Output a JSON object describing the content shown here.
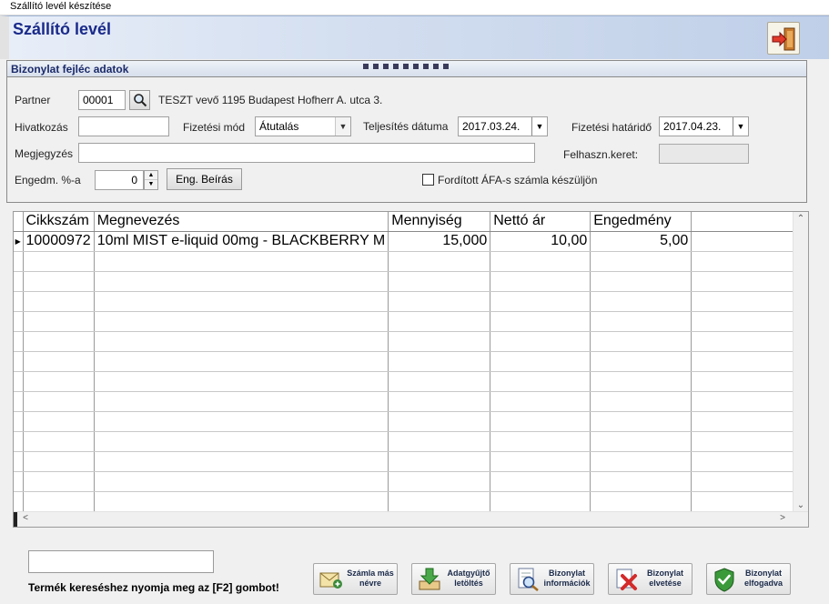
{
  "window": {
    "title": "Szállító levél készítése"
  },
  "header": {
    "title": "Szállító levél",
    "exit_icon": "exit-door-icon"
  },
  "panel": {
    "title": "Bizonylat fejléc adatok",
    "partner_label": "Partner",
    "partner_code": "00001",
    "partner_name": "TESZT vevő 1195 Budapest Hofherr A. utca 3.",
    "hivatkozas_label": "Hivatkozás",
    "hivatkozas_value": "",
    "fizetesi_mod_label": "Fizetési mód",
    "fizetesi_mod_value": "Átutalás",
    "teljesites_label": "Teljesítés dátuma",
    "teljesites_value": "2017.03.24.",
    "hatarido_label": "Fizetési határidő",
    "hatarido_value": "2017.04.23.",
    "megjegyzes_label": "Megjegyzés",
    "megjegyzes_value": "",
    "felhkeret_label": "Felhaszn.keret:",
    "felhkeret_value": "",
    "engedm_label": "Engedm. %-a",
    "engedm_value": "0",
    "eng_beiras_label": "Eng. Beírás",
    "forditott_afa_label": "Fordított ÁFA-s számla készüljön",
    "forditott_afa_checked": false
  },
  "grid": {
    "columns": [
      "Cikkszám",
      "Megnevezés",
      "Mennyiség",
      "Nettó ár",
      "Engedmény"
    ],
    "rows": [
      {
        "cikkszam": "10000972",
        "megnevezes": "10ml MIST e-liquid 00mg - BLACKBERRY M",
        "mennyiseg": "15,000",
        "netto_ar": "10,00",
        "engedmeny": "5,00"
      }
    ]
  },
  "footer": {
    "search_value": "",
    "hint": "Termék kereséshez nyomja meg az [F2] gombot!",
    "buttons": [
      {
        "line1": "Számla más",
        "line2": "névre",
        "icon": "invoice-envelope-icon"
      },
      {
        "line1": "Adatgyűjtő",
        "line2": "letöltés",
        "icon": "download-arrow-icon"
      },
      {
        "line1": "Bizonylat",
        "line2": "információk",
        "icon": "document-magnifier-icon"
      },
      {
        "line1": "Bizonylat",
        "line2": "elvetése",
        "icon": "reject-x-icon"
      },
      {
        "line1": "Bizonylat",
        "line2": "elfogadva",
        "icon": "accept-check-icon"
      }
    ]
  }
}
